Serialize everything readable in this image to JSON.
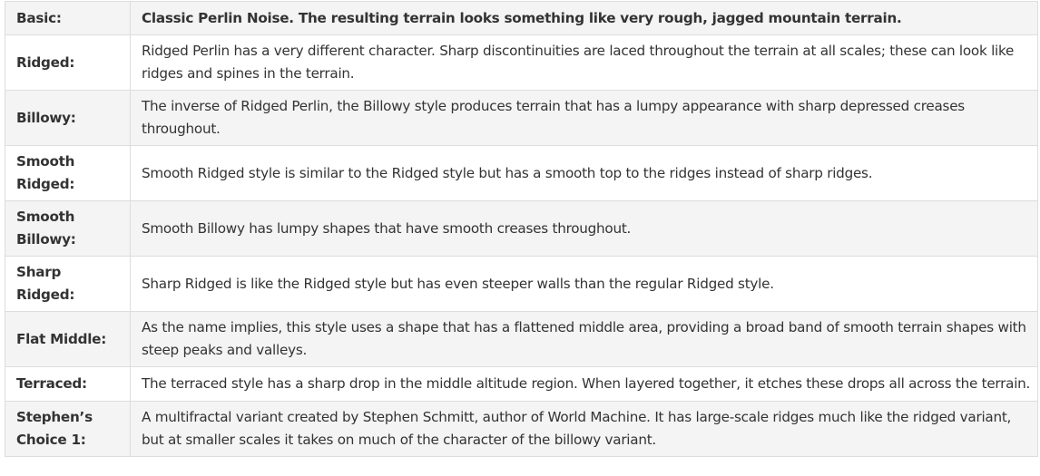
{
  "rows": [
    {
      "name": "Basic:",
      "description": "Classic Perlin Noise. The resulting terrain looks something like very rough, jagged mountain terrain."
    },
    {
      "name": "Ridged:",
      "description": "Ridged Perlin has a very different character. Sharp discontinuities are laced throughout the terrain at all scales; these can look like ridges and spines in the terrain."
    },
    {
      "name": "Billowy:",
      "description": "The inverse of Ridged Perlin, the Billowy style produces terrain that has a lumpy appearance with sharp depressed creases throughout."
    },
    {
      "name": "Smooth Ridged:",
      "description": "Smooth Ridged style is similar to the Ridged style but has a smooth top to the ridges instead of sharp ridges."
    },
    {
      "name": "Smooth Billowy:",
      "description": "Smooth Billowy has lumpy shapes that have smooth creases throughout."
    },
    {
      "name": "Sharp Ridged:",
      "description": "Sharp Ridged is like the Ridged style but has even steeper walls than the regular Ridged style."
    },
    {
      "name": "Flat Middle:",
      "description": "As the name implies, this style uses a shape that has a flattened middle area, providing a broad band of smooth terrain shapes with steep peaks and valleys."
    },
    {
      "name": "Terraced:",
      "description": "The terraced style has a sharp drop in the middle altitude region. When layered together, it etches these drops all across the terrain."
    },
    {
      "name": "Stephen’s Choice 1:",
      "description": "A multifractal variant created by Stephen Schmitt, author of World Machine. It has large-scale ridges much like the ridged variant, but at smaller scales it takes on much of the character of the billowy variant."
    }
  ]
}
